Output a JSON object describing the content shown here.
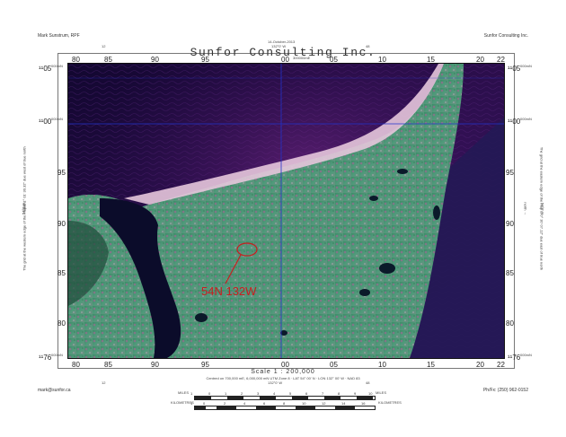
{
  "header": {
    "author": "Mark Sunstrum, RPF",
    "company": "Sunfor Consulting Inc.",
    "date": "14-October-2013",
    "top_coord": "132°0' W",
    "top_tick_left": "12",
    "top_tick_right": "48",
    "map_title": "Sunfor Consulting Inc."
  },
  "grid": {
    "easting_top": [
      "80",
      "85",
      "90",
      "95",
      "00",
      "05",
      "10",
      "15",
      "20"
    ],
    "easting_top_sup": "300000mE",
    "northing_labels": [
      "95",
      "90",
      "85",
      "80"
    ],
    "northing_top_left": "¹¹05",
    "northing_top_right": "¹¹05",
    "northing_mid_left": "¹¹00",
    "northing_mid_right": "¹¹00",
    "northing_bottom_left": "¹¹76",
    "northing_bottom_right": "¹¹76",
    "northing_sup": "000mN",
    "easting_bottom": [
      "80",
      "85",
      "90",
      "95",
      "00",
      "05",
      "10",
      "15",
      "20"
    ],
    "corner_tl": "80",
    "corner_tr": "22",
    "corner_bl": "80",
    "corner_br": "22"
  },
  "map": {
    "annotation": "54N 132W",
    "annotation_color": "#c81e1e",
    "gridline_color": "#2233cc"
  },
  "margins": {
    "left_note": "The grid at the western edge of the map is 1° 01' 30.32\" due west of true north",
    "right_note": "The grid at the eastern edge of the map is 0° 30' 07.12\" due east of true north",
    "left_lat": "54°0' N",
    "right_lat": "54°0' N",
    "left_north": "← north",
    "right_north": "north →"
  },
  "footer": {
    "scale_label": "Scale  1 : 200,000",
    "projection_note": "Centred on 700,000 mE, 6,000,000 mN  UTM Zone 8   ·   LAT 54° 00' N   ·   LON 132° 00' W   ·   NAD 83",
    "bottom_coord": "132°0' W",
    "bottom_tick_left": "12",
    "bottom_tick_right": "48",
    "email": "mark@sunfor.ca",
    "phone": "Ph/Fx: (250) 962-0152",
    "miles_label": "MILES",
    "miles_ticks": [
      "1",
      "0",
      "1",
      "2",
      "3",
      "4",
      "5",
      "6",
      "7",
      "8",
      "9",
      "10"
    ],
    "miles_unit": "MILES",
    "km_label": "KILOMETRES",
    "km_ticks": [
      "1",
      "0",
      "2",
      "4",
      "6",
      "8",
      "10",
      "12",
      "14",
      "16"
    ],
    "km_unit": "KILOMETRES"
  }
}
